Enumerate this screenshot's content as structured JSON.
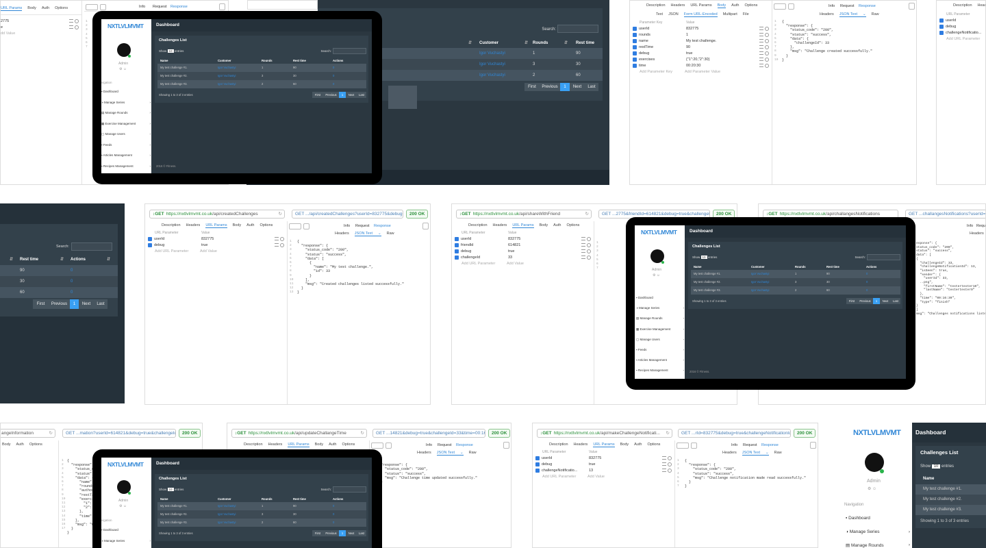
{
  "api_common": {
    "tabs_request": [
      "Description",
      "Headers",
      "URL Params",
      "Body",
      "Auth",
      "Options"
    ],
    "tabs_response": [
      "Info",
      "Request",
      "Response"
    ],
    "tabs_response_body": [
      "Headers",
      "JSON Text",
      "Raw"
    ],
    "param_header_key": "URL Parameter",
    "param_header_value": "Value",
    "add_key": "Add URL Parameter",
    "add_value": "Add Value",
    "status": "200 OK"
  },
  "api_created": {
    "method": "GET",
    "host": "https://nxtlvlmvmt.co.uk",
    "path": "/api/createdChallenges",
    "right_url": "GET .../api/createdChallenges?userId=832775&debug=true",
    "params": [
      {
        "k": "userId",
        "v": "832775"
      },
      {
        "k": "debug",
        "v": "true"
      }
    ],
    "json": [
      "{",
      "  \"response\": {",
      "    \"status_code\": \"200\",",
      "    \"status\": \"success\",",
      "    \"data\": [",
      "      {",
      "        \"name\": \"My test challenge.\",",
      "        \"id\": 33",
      "      }",
      "    ],",
      "    \"msg\": \"Created challenges listed successfully.\"",
      "  }",
      "}"
    ]
  },
  "api_share": {
    "method": "GET",
    "host": "https://nxtlvlmvmt.co.uk",
    "path": "/api/shareWithFriend",
    "right_url": "GET ...2775&friendId=614821&debug=true&challengeId=33",
    "params": [
      {
        "k": "userId",
        "v": "832775"
      },
      {
        "k": "friendId",
        "v": "614821"
      },
      {
        "k": "debug",
        "v": "true"
      },
      {
        "k": "challengeId",
        "v": "33"
      }
    ]
  },
  "api_notif": {
    "method": "GET",
    "host": "https://nxtlvlmvmt.co.uk",
    "path": "/api/challangesNotifications",
    "right_url": "GET ...challangesNotifications?userId=8327"
  },
  "api_update": {
    "method": "GET",
    "host": "https://nxtlvlmvmt.co.uk",
    "path": "/api/updateChallangeTime",
    "right_url": "GET ...14821&debug=true&challengeId=33&time=00:16:30",
    "json": [
      "{",
      "  \"response\": {",
      "    \"status_code\": \"200\",",
      "    \"status\": \"success\",",
      "    \"msg\": \"Challenge time updated successfully.\"",
      "  }",
      "}"
    ]
  },
  "api_make": {
    "method": "GET",
    "host": "https://nxtlvlmvmt.co.uk",
    "path": "/api/makeChallengeNotificati...",
    "right_url": "GET ...rId=832775&debug=true&challengeNotificationId=13",
    "params": [
      {
        "k": "userId",
        "v": "832775"
      },
      {
        "k": "debug",
        "v": "true"
      },
      {
        "k": "challengeNotificatio...",
        "v": "13"
      }
    ],
    "json": [
      "{",
      "  \"response\": {",
      "    \"status_code\": \"200\",",
      "    \"status\": \"success\",",
      "    \"msg\": \"Challenge notification made read successfully.\"",
      "  }",
      "}"
    ]
  },
  "api_info": {
    "url_tail": "angeInformation",
    "right_url": "GET ...mation?userId=614821&debug=true&challengeId=33"
  },
  "api_body": {
    "body_tabs": [
      "Text",
      "JSON",
      "Form URL-Encoded",
      "Multipart",
      "File"
    ],
    "param_header_key": "Parameter Key",
    "param_header_value": "Value",
    "add_key": "Add Parameter Key",
    "add_value": "Add Parameter Value",
    "params": [
      {
        "k": "userId",
        "v": "832775"
      },
      {
        "k": "rounds",
        "v": "1"
      },
      {
        "k": "name",
        "v": "My test challenge."
      },
      {
        "k": "restTime",
        "v": "90"
      },
      {
        "k": "debug",
        "v": "true"
      },
      {
        "k": "exercises",
        "v": "{\"1\":20,\"2\":30}"
      },
      {
        "k": "time",
        "v": "00:20:30"
      }
    ],
    "json": [
      "{",
      "  \"response\": {",
      "    \"status_code\": \"200\",",
      "    \"status\": \"success\",",
      "    \"data\": {",
      "      \"challengeId\": 33",
      "    },",
      "    \"msg\": \"Challenge created successfully.\"",
      "  }",
      "}"
    ]
  },
  "dashboard": {
    "logo": "NXTLVLMVMT",
    "role": "Admin",
    "nav_title": "Navigation",
    "title": "Dashboard",
    "card_title": "Challenges List",
    "show": "Show",
    "show_value": "10",
    "entries": "entries",
    "search": "Search:",
    "columns": [
      "Name",
      "Customer",
      "Rounds",
      "Rest time",
      "Actions"
    ],
    "rows": [
      {
        "name": "My test challenge #1.",
        "customer": "Igor Vuchastyi",
        "rounds": "1",
        "rest": "90",
        "action": "0"
      },
      {
        "name": "My test challenge #2.",
        "customer": "Igor Vuchastyi",
        "rounds": "3",
        "rest": "30",
        "action": "0"
      },
      {
        "name": "My test challenge #3.",
        "customer": "Igor Vuchastyi",
        "rounds": "2",
        "rest": "60",
        "action": "0"
      }
    ],
    "showing": "Showing 1 to 3 of 3 entries",
    "pagination": [
      "First",
      "Previous",
      "1",
      "Next",
      "Last"
    ],
    "footer": "2016 © Fitness.",
    "menu": [
      "Dashboard",
      "Manage Series",
      "Manage Rounds",
      "Exercise Management",
      "Manage Users",
      "Feeds",
      "Articles Management",
      "Recipes Management"
    ]
  }
}
